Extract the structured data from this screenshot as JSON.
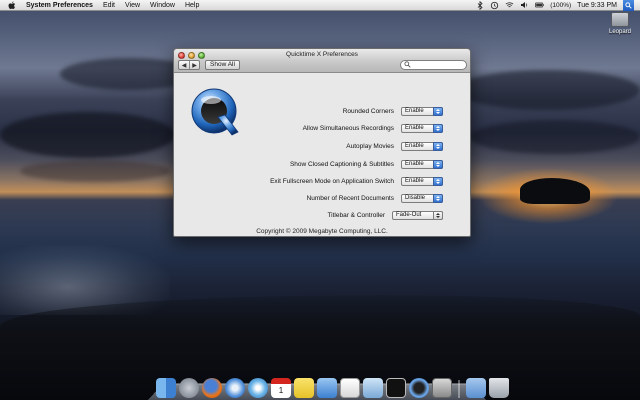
{
  "menubar": {
    "app_name": "System Preferences",
    "menus": [
      "Edit",
      "View",
      "Window",
      "Help"
    ],
    "battery": "(100%)",
    "clock": "Tue 9:33 PM"
  },
  "desktop": {
    "drive_label": "Leopard"
  },
  "window": {
    "title": "Quicktime X Preferences",
    "show_all": "Show All",
    "search_placeholder": "",
    "settings": [
      {
        "label": "Rounded Corners",
        "value": "Enable"
      },
      {
        "label": "Allow Simultaneous Recordings",
        "value": "Enable"
      },
      {
        "label": "Autoplay Movies",
        "value": "Enable"
      },
      {
        "label": "Show Closed Captioning & Subtitles",
        "value": "Enable"
      },
      {
        "label": "Exit Fullscreen Mode on Application Switch",
        "value": "Enable"
      },
      {
        "label": "Number of Recent Documents",
        "value": "Disable"
      },
      {
        "label": "Titlebar & Controller",
        "value": "Fade-Out"
      }
    ],
    "copyright": "Copyright © 2009 Megabyte Computing, LLC."
  },
  "dock": {
    "icons": [
      "finder-icon",
      "system-preferences-icon",
      "firefox-icon",
      "safari-icon",
      "itunes-icon",
      "ical-icon",
      "stickies-icon",
      "mail-icon",
      "textedit-icon",
      "preview-icon",
      "terminal-icon",
      "quicktime-icon",
      "calculator-icon",
      "applications-folder-icon",
      "trash-icon"
    ]
  },
  "colors": {
    "accent_blue": "#2f6fd0",
    "window_bg": "#e8e8e8",
    "quicktime_blue": "#1e63b8"
  }
}
